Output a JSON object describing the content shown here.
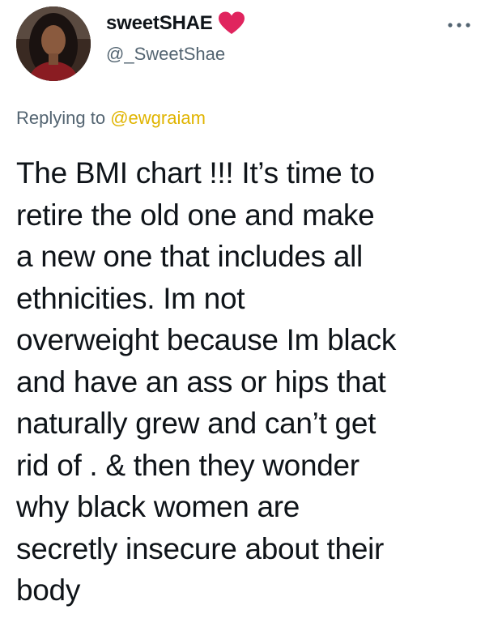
{
  "author": {
    "display_name": "sweetSHAE",
    "handle": "@_SweetShae",
    "name_emoji": "red-heart-icon",
    "avatar": "avatar"
  },
  "menu": {
    "icon": "more-options-icon"
  },
  "reply": {
    "prefix": "Replying to",
    "mention": "@ewgraiam"
  },
  "body": {
    "lines": [
      "The BMI chart !!! It’s time to",
      "retire the old one and make",
      "a new one that includes all",
      "ethnicities. Im not",
      "overweight because Im black",
      "and have an ass or hips that",
      "naturally grew and can’t get",
      "rid of . & then they wonder",
      "why black women are",
      "secretly insecure about their",
      "body"
    ]
  },
  "colors": {
    "text": "#0f1419",
    "secondary": "#536471",
    "mention": "#e0b400",
    "heart": "#e0245e"
  }
}
